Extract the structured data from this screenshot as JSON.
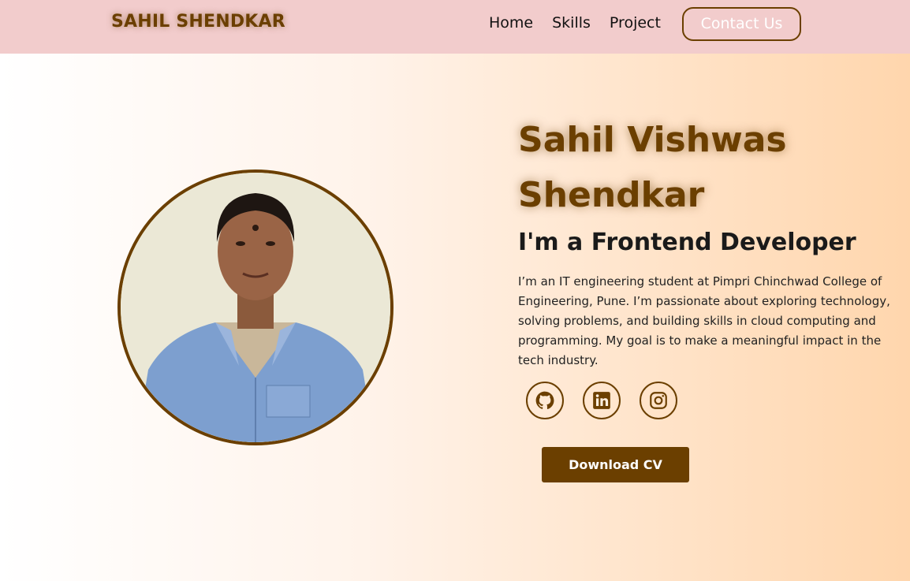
{
  "nav": {
    "brand": "SAHIL SHENDKAR",
    "links": [
      "Home",
      "Skills",
      "Project"
    ],
    "contact_label": "Contact Us"
  },
  "hero": {
    "name_line1": "Sahil Vishwas",
    "name_line2": "Shendkar",
    "role": "I'm a Frontend Developer",
    "bio": "I’m an IT engineering student at Pimpri Chinchwad College of Engineering, Pune. I’m passionate about exploring technology, solving problems, and building skills in cloud computing and programming. My goal is to make a meaningful impact in the tech industry.",
    "socials": [
      "github-icon",
      "linkedin-icon",
      "instagram-icon"
    ],
    "download_label": "Download CV"
  },
  "colors": {
    "accent": "#6b3f00",
    "nav_bg": "#f2cccc",
    "gradient_end": "#ffd6ad"
  }
}
